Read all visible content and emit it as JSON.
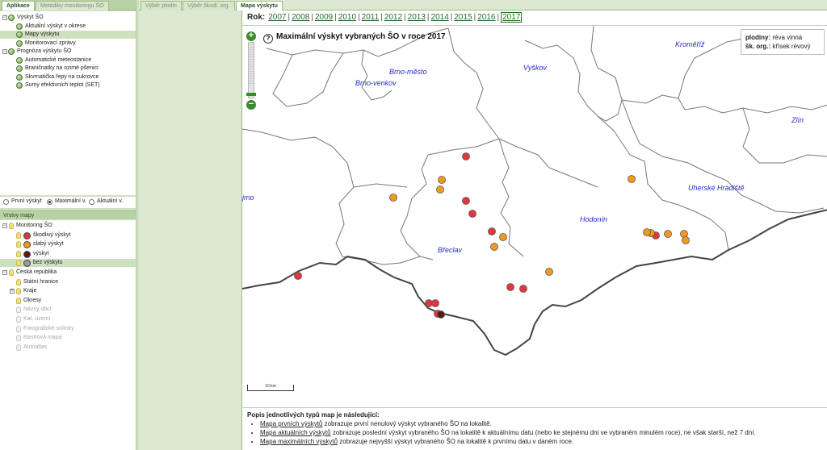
{
  "left_tabs": [
    {
      "label": "Aplikace",
      "active": true
    },
    {
      "label": "Metodiky monitoringu ŠO",
      "active": false
    }
  ],
  "tree": [
    {
      "label": "Výskyt ŠO",
      "level": 0,
      "expander": "−",
      "selected": false
    },
    {
      "label": "Aktuální výskyt v okrese",
      "level": 1,
      "selected": false
    },
    {
      "label": "Mapy výskytu",
      "level": 1,
      "selected": true
    },
    {
      "label": "Monitorovací zprávy",
      "level": 1,
      "selected": false
    },
    {
      "label": "Prognóza výskytu ŠO",
      "level": 0,
      "expander": "−",
      "selected": false
    },
    {
      "label": "Automatické meteostanice",
      "level": 1,
      "selected": false
    },
    {
      "label": "Braničnatky na ozimé pšenici",
      "level": 1,
      "selected": false
    },
    {
      "label": "Skvrnatička řepy na cukrovce",
      "level": 1,
      "selected": false
    },
    {
      "label": "Sumy efektivních teplot (SET)",
      "level": 1,
      "selected": false
    }
  ],
  "map_modes": [
    {
      "label": "První výskyt",
      "checked": false
    },
    {
      "label": "Maximální v.",
      "checked": true
    },
    {
      "label": "Aktuální v.",
      "checked": false
    }
  ],
  "layers_title": "Vrstvy mapy",
  "layers": [
    {
      "label": "Monitoring ŠO",
      "level": 0,
      "type": "group",
      "expander": "−",
      "on": true
    },
    {
      "label": "škodlivý výskyt",
      "level": 1,
      "type": "dot",
      "color": "#e0383e"
    },
    {
      "label": "slabý výskyt",
      "level": 1,
      "type": "dot",
      "color": "#f39a1e"
    },
    {
      "label": "výskyt",
      "level": 1,
      "type": "dot",
      "color": "#5c1a10"
    },
    {
      "label": "bez výskytu",
      "level": 1,
      "type": "dot",
      "color": "#9a9a9a",
      "selected": true
    },
    {
      "label": "Česká republika",
      "level": 0,
      "type": "group",
      "expander": "−",
      "on": true
    },
    {
      "label": "Státní hranice",
      "level": 1,
      "type": "bulb",
      "on": true
    },
    {
      "label": "Kraje",
      "level": 1,
      "type": "bulb",
      "on": true,
      "expander": "+"
    },
    {
      "label": "Okresy",
      "level": 1,
      "type": "bulb",
      "on": true
    },
    {
      "label": "Názvy obcí",
      "level": 1,
      "type": "bulb",
      "on": false
    },
    {
      "label": "Kat. území",
      "level": 1,
      "type": "bulb",
      "on": false
    },
    {
      "label": "Fotografické snímky",
      "level": 1,
      "type": "bulb",
      "on": false
    },
    {
      "label": "Rastrová mapa",
      "level": 1,
      "type": "bulb",
      "on": false
    },
    {
      "label": "Autoatlas",
      "level": 1,
      "type": "bulb",
      "on": false
    }
  ],
  "right_tabs": [
    {
      "label": "Výběr plodin",
      "active": false
    },
    {
      "label": "Výběr škodl. org.",
      "active": false
    },
    {
      "label": "Mapa výskytu",
      "active": true
    }
  ],
  "year_label": "Rok:",
  "years": [
    "2007",
    "2008",
    "2009",
    "2010",
    "2011",
    "2012",
    "2013",
    "2014",
    "2015",
    "2016",
    "2017"
  ],
  "current_year": "2017",
  "map": {
    "help_icon": "question-icon",
    "title": "Maximální výskyt vybraných ŠO v roce 2017",
    "info": {
      "crop_label": "plodiny:",
      "crop_value": "réva vinná",
      "org_label": "šk. org.:",
      "org_value": "křísek révový"
    },
    "region_labels": [
      "Brno-město",
      "Brno-venkov",
      "Vyškov",
      "Kroměříž",
      "Zlín",
      "Uherské Hradiště",
      "Hodonín",
      "Břeclav",
      "jmo"
    ],
    "scale_label": "10 km",
    "observations": [
      {
        "district": "Břeclav",
        "severity": "škodlivý výskyt"
      },
      {
        "district": "Břeclav",
        "severity": "škodlivý výskyt"
      },
      {
        "district": "Břeclav",
        "severity": "škodlivý výskyt"
      },
      {
        "district": "Břeclav",
        "severity": "škodlivý výskyt"
      },
      {
        "district": "Břeclav",
        "severity": "škodlivý výskyt"
      },
      {
        "district": "Břeclav",
        "severity": "škodlivý výskyt"
      },
      {
        "district": "Břeclav",
        "severity": "škodlivý výskyt"
      },
      {
        "district": "Břeclav",
        "severity": "škodlivý výskyt"
      },
      {
        "district": "Břeclav",
        "severity": "škodlivý výskyt"
      },
      {
        "district": "Břeclav",
        "severity": "škodlivý výskyt"
      },
      {
        "district": "Břeclav",
        "severity": "slabý výskyt"
      },
      {
        "district": "Břeclav",
        "severity": "slabý výskyt"
      },
      {
        "district": "Břeclav",
        "severity": "slabý výskyt"
      },
      {
        "district": "Břeclav",
        "severity": "slabý výskyt"
      },
      {
        "district": "Břeclav",
        "severity": "slabý výskyt"
      },
      {
        "district": "Břeclav",
        "severity": "výskyt"
      },
      {
        "district": "Hodonín",
        "severity": "škodlivý výskyt"
      },
      {
        "district": "Hodonín",
        "severity": "slabý výskyt"
      },
      {
        "district": "Hodonín",
        "severity": "slabý výskyt"
      },
      {
        "district": "Hodonín",
        "severity": "slabý výskyt"
      },
      {
        "district": "Hodonín",
        "severity": "slabý výskyt"
      },
      {
        "district": "Hodonín",
        "severity": "slabý výskyt"
      },
      {
        "district": "Hodonín",
        "severity": "slabý výskyt"
      },
      {
        "district": "Hodonín",
        "severity": "slabý výskyt"
      }
    ]
  },
  "description": {
    "heading": "Popis jednotlivých typů map je následující:",
    "items": [
      {
        "link": "Mapa prvních výskytů",
        "text": " zobrazuje první nenulový výskyt vybraného ŠO na lokalitě."
      },
      {
        "link": "Mapa aktuálních výskytů",
        "text": " zobrazuje poslední výskyt vybraného ŠO na lokalitě k aktuálnímu datu (nebo ke stejnému dni ve vybraném minulém roce), ne však starší, než 7 dní."
      },
      {
        "link": "Mapa maximálních výskytů",
        "text": " zobrazuje nejvyšší výskyt vybraného ŠO na lokalitě k prvnímu datu v daném roce."
      }
    ]
  }
}
